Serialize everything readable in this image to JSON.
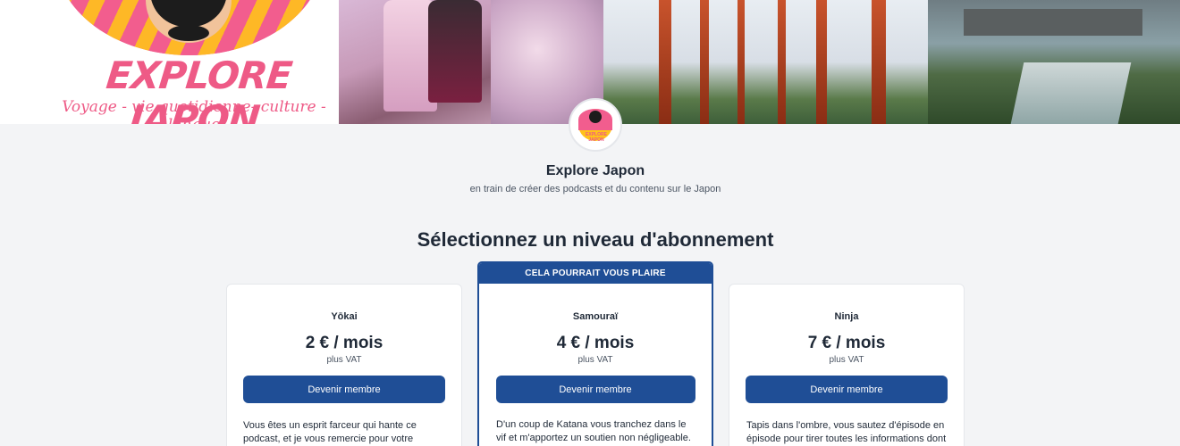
{
  "banner": {
    "logo_title": "EXPLORE JAPON",
    "logo_tagline": "Voyage - vie quotidienne- culture - langue"
  },
  "profile": {
    "name": "Explore Japon",
    "description": "en train de créer des podcasts et du contenu sur le Japon"
  },
  "page": {
    "section_title": "Sélectionnez un niveau d'abonnement"
  },
  "tiers": [
    {
      "name": "Yōkai",
      "price": "2 € / mois",
      "vat": "plus VAT",
      "button": "Devenir membre",
      "description": "Vous êtes un esprit farceur qui hante ce podcast, et je vous remercie pour votre"
    },
    {
      "badge": "CELA POURRAIT VOUS PLAIRE",
      "name": "Samouraï",
      "price": "4 € / mois",
      "vat": "plus VAT",
      "button": "Devenir membre",
      "description": "D'un coup de Katana vous tranchez dans le vif et m'apportez un soutien non négligeable."
    },
    {
      "name": "Ninja",
      "price": "7 € / mois",
      "vat": "plus VAT",
      "button": "Devenir membre",
      "description": "Tapis dans l'ombre, vous sautez d'épisode en épisode pour tirer toutes les informations dont"
    }
  ],
  "colors": {
    "accent": "#1f4e96",
    "background": "#f3f4f6",
    "logo_pink": "#ee5a86",
    "logo_yellow": "#ffc21a"
  }
}
